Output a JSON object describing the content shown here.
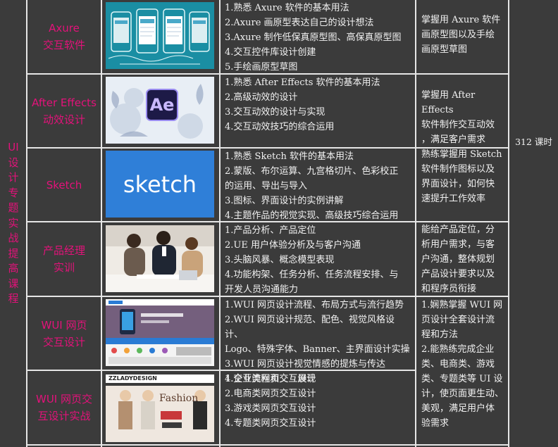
{
  "side_title": [
    "UI",
    "设",
    "计",
    "专",
    "题",
    "实",
    "战",
    "提",
    "高",
    "课",
    "程"
  ],
  "total_hours": "312 课时",
  "colors": {
    "accent": "#e3127a",
    "background": "#3b3b3b",
    "grid": "#e6e6e6",
    "text": "#f2f2f2"
  },
  "rows": [
    {
      "course": "Axure\n交互软件",
      "image": "axure-wireframe-thumbnail",
      "content": "1.熟悉 Axure 软件的基本用法\n2.Axure 画原型表达自己的设计想法\n3.Axure 制作低保真原型图、高保真原型图\n4.交互控件库设计创建\n5.手绘画原型草图",
      "goal": "掌握用 Axure 软件\n画原型图以及手绘\n画原型草图"
    },
    {
      "course": "After Effects\n动效设计",
      "image": "after-effects-logo-thumbnail",
      "image_text": "Ae",
      "content": "1.熟悉 After Effects 软件的基本用法\n2.高级动效的设计\n3.交互动效的设计与实现\n4.交互动效技巧的综合运用",
      "goal": "掌握用 After Effects\n软件制作交互动效\n，满足客户需求"
    },
    {
      "course": "Sketch",
      "image": "sketch-logo-thumbnail",
      "image_text": "sketch",
      "content": "1.熟悉 Sketch 软件的基本用法\n2.蒙版、布尔运算、九宫格切片、色彩校正\n的运用、导出与导入\n3.图标、界面设计的实例讲解\n4.主题作品的视觉实现、高级技巧综合运用",
      "goal": "熟练掌握用 Sketch\n软件制作图标以及\n界面设计，如何快\n速提升工作效率"
    },
    {
      "course": "产品经理\n实训",
      "image": "business-meeting-photo",
      "content": "1.产品分析、产品定位\n2.UE 用户体验分析及与客户沟通\n3.头脑风暴、概念模型表现\n4.功能构架、任务分析、任务流程安排、与\n开发人员沟通能力",
      "goal": "能给产品定位，分\n析用户需求，与客\n户沟通，整体规划\n产品设计要求以及\n和程序员衔接"
    },
    {
      "course": "WUI 网页\n交互设计",
      "image": "web-page-screenshot",
      "content": "1.WUI 网页设计流程、布局方式与流行趋势\n2.WUI 网页设计规范、配色、视觉风格设计、\nLogo、特殊字体、Banner、主界面设计实操\n3.WUI 网页设计视觉情感的提炼与传达\n4.交互流程和交互展现",
      "goal": "1.娴熟掌握 WUI 网\n页设计全套设计流\n程和方法\n2.能熟练完成企业\n类、电商类、游戏\n类、专题类等 UI 设\n计，使页面更生动、\n美观，满足用户体\n验需求"
    },
    {
      "course": "WUI 网页交\n互设计实战",
      "image": "fashion-ecommerce-screenshot",
      "image_text": "ZZLADYDESIGN",
      "image_text2": "Fashion",
      "content": "1.企业类网页交互设计\n2.电商类网页交互设计\n3.游戏类网页交互设计\n4.专题类网页交互设计"
    }
  ]
}
